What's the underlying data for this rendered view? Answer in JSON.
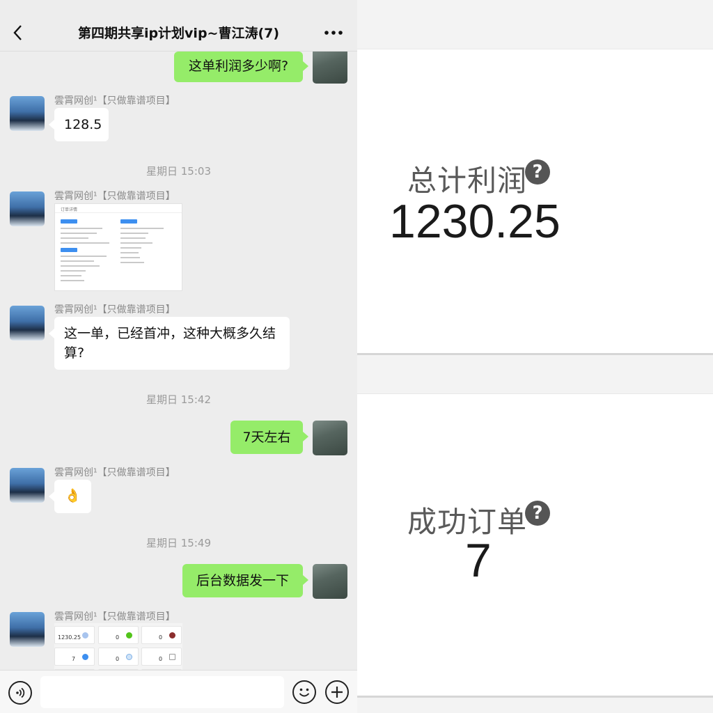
{
  "chat": {
    "title": "第四期共享ip计划vip~曹江涛(7)",
    "sender_name": "雲霄网创¹【只做靠谱项目】",
    "messages": {
      "m1": "这单利润多少啊?",
      "m2": "128.5",
      "ts1": "星期日 15:03",
      "m4": "这一单，已经首冲，这种大概多久结算?",
      "ts2": "星期日 15:42",
      "m5": "7天左右",
      "m6_emoji": "👌",
      "ts3": "星期日 15:49",
      "m7": "后台数据发一下"
    },
    "thumbnail_order": {
      "title": "订单详情"
    },
    "thumbnail_grid": {
      "v1": "1230.25",
      "v2": "0",
      "v3": "0",
      "v4": "7",
      "v5": "0",
      "v6": "0"
    },
    "input_placeholder": ""
  },
  "zoom": {
    "card1": {
      "label": "总计利润",
      "help": "?",
      "value": "1230.25"
    },
    "card2": {
      "label": "成功订单",
      "help": "?",
      "value": "7"
    }
  },
  "colors": {
    "self_bubble": "#95ec69",
    "other_bubble": "#ffffff",
    "background": "#ededed"
  }
}
